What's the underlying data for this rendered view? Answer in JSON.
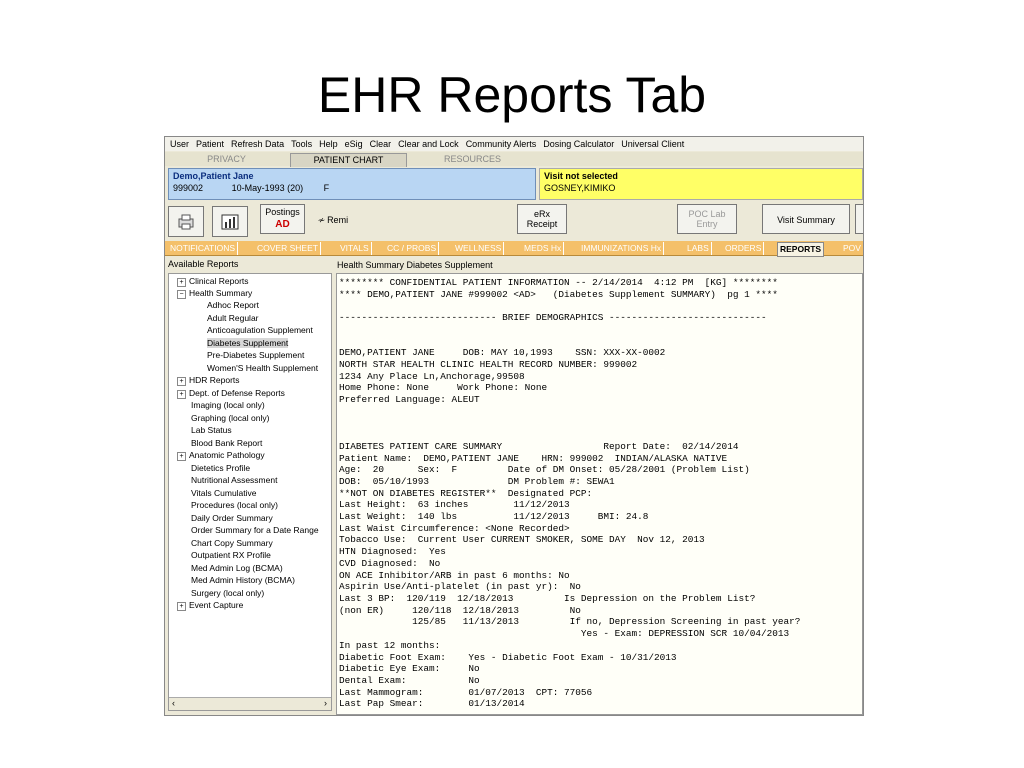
{
  "slide": {
    "title": "EHR Reports Tab"
  },
  "menu": [
    "User",
    "Patient",
    "Refresh Data",
    "Tools",
    "Help",
    "eSig",
    "Clear",
    "Clear and Lock",
    "Community Alerts",
    "Dosing Calculator",
    "Universal Client"
  ],
  "top_tabs": {
    "privacy": "PRIVACY",
    "patient_chart": "PATIENT CHART",
    "resources": "RESOURCES"
  },
  "patient": {
    "name": "Demo,Patient Jane",
    "id": "999002",
    "dob": "10-May-1993",
    "age": "(20)",
    "sex": "F"
  },
  "visit": {
    "status": "Visit not selected",
    "provider": "GOSNEY,KIMIKO"
  },
  "toolbar": {
    "postings_label": "Postings",
    "postings_value": "AD",
    "remi_label": "Remi",
    "erx_label_1": "eRx",
    "erx_label_2": "Receipt",
    "poc_label_1": "POC Lab",
    "poc_label_2": "Entry",
    "visit_summary": "Visit Summary"
  },
  "chart_tabs": [
    "NOTIFICATIONS",
    "COVER SHEET",
    "VITALS",
    "CC / PROBS",
    "WELLNESS",
    "MEDS Hx",
    "IMMUNIZATIONS Hx",
    "LABS",
    "ORDERS",
    "REPORTS",
    "POV"
  ],
  "left_panel": {
    "label": "Available Reports",
    "items": [
      {
        "label": "Clinical Reports",
        "expander": "+"
      },
      {
        "label": "Health Summary",
        "expander": "−"
      },
      {
        "label": "Adhoc Report"
      },
      {
        "label": "Adult Regular"
      },
      {
        "label": "Anticoagulation Supplement"
      },
      {
        "label": "Diabetes Supplement",
        "selected": true
      },
      {
        "label": "Pre-Diabetes Supplement"
      },
      {
        "label": "Women'S Health Supplement"
      },
      {
        "label": "HDR Reports",
        "expander": "+"
      },
      {
        "label": "Dept. of Defense Reports",
        "expander": "+"
      },
      {
        "label": "Imaging (local only)"
      },
      {
        "label": "Graphing (local only)"
      },
      {
        "label": "Lab Status"
      },
      {
        "label": "Blood Bank Report"
      },
      {
        "label": "Anatomic Pathology",
        "expander": "+"
      },
      {
        "label": "Dietetics Profile"
      },
      {
        "label": "Nutritional Assessment"
      },
      {
        "label": "Vitals Cumulative"
      },
      {
        "label": "Procedures (local only)"
      },
      {
        "label": "Daily Order Summary"
      },
      {
        "label": "Order Summary for a Date Range"
      },
      {
        "label": "Chart Copy Summary"
      },
      {
        "label": "Outpatient RX Profile"
      },
      {
        "label": "Med Admin Log (BCMA)"
      },
      {
        "label": "Med Admin History (BCMA)"
      },
      {
        "label": "Surgery (local only)"
      },
      {
        "label": "Event Capture",
        "expander": "+"
      }
    ]
  },
  "report": {
    "title": "Health Summary Diabetes Supplement",
    "lines": [
      "******** CONFIDENTIAL PATIENT INFORMATION -- 2/14/2014  4:12 PM  [KG] ********",
      "**** DEMO,PATIENT JANE #999002 <AD>   (Diabetes Supplement SUMMARY)  pg 1 ****",
      "",
      "---------------------------- BRIEF DEMOGRAPHICS ----------------------------",
      "",
      "",
      "DEMO,PATIENT JANE     DOB: MAY 10,1993    SSN: XXX-XX-0002",
      "NORTH STAR HEALTH CLINIC HEALTH RECORD NUMBER: 999002",
      "1234 Any Place Ln,Anchorage,99508",
      "Home Phone: None     Work Phone: None",
      "Preferred Language: ALEUT",
      "",
      "",
      "",
      "DIABETES PATIENT CARE SUMMARY                  Report Date:  02/14/2014",
      "Patient Name:  DEMO,PATIENT JANE    HRN: 999002  INDIAN/ALASKA NATIVE",
      "Age:  20      Sex:  F         Date of DM Onset: 05/28/2001 (Problem List)",
      "DOB:  05/10/1993              DM Problem #: SEWA1",
      "**NOT ON DIABETES REGISTER**  Designated PCP:",
      "Last Height:  63 inches        11/12/2013",
      "Last Weight:  140 lbs          11/12/2013     BMI: 24.8",
      "Last Waist Circumference: <None Recorded>",
      "Tobacco Use:  Current User CURRENT SMOKER, SOME DAY  Nov 12, 2013",
      "HTN Diagnosed:  Yes",
      "CVD Diagnosed:  No",
      "ON ACE Inhibitor/ARB in past 6 months: No",
      "Aspirin Use/Anti-platelet (in past yr):  No",
      "Last 3 BP:  120/119  12/18/2013         Is Depression on the Problem List?",
      "(non ER)     120/118  12/18/2013         No",
      "             125/85   11/13/2013         If no, Depression Screening in past year?",
      "                                           Yes - Exam: DEPRESSION SCR 10/04/2013",
      "In past 12 months:",
      "Diabetic Foot Exam:    Yes - Diabetic Foot Exam - 10/31/2013",
      "Diabetic Eye Exam:     No",
      "Dental Exam:           No",
      "Last Mammogram:        01/07/2013  CPT: 77056",
      "Last Pap Smear:        01/13/2014"
    ]
  },
  "colors": {
    "patient_bg": "#b9d6f3",
    "visit_bg": "#ffff66",
    "chart_tabs_bg": "#f4c06a"
  },
  "icons": [
    "print-icon",
    "chart-icon",
    "remi-icon",
    "scroll-left-icon",
    "scroll-right-icon"
  ]
}
